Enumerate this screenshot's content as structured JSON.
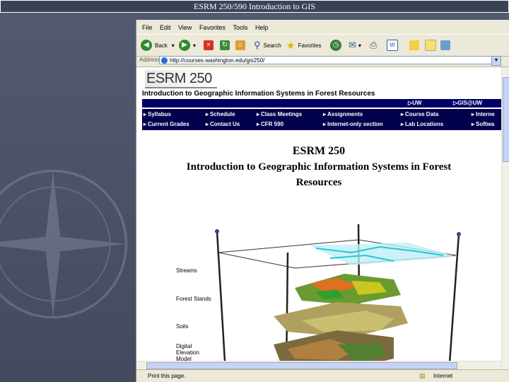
{
  "slide": {
    "title": "ESRM 250/590 Introduction to GIS"
  },
  "browser": {
    "menu": [
      "File",
      "Edit",
      "View",
      "Favorites",
      "Tools",
      "Help"
    ],
    "toolbar": {
      "back_label": "Back",
      "search_label": "Search",
      "favorites_label": "Favorites"
    },
    "address": {
      "label": "Address",
      "url": "http://courses.washington.edu/gis250/"
    },
    "status": {
      "text": "Print this page.",
      "zone": "Internet"
    }
  },
  "page": {
    "logo": "ESRM 250",
    "subtitle": "Introduction to Geographic Information Systems in Forest Resources",
    "top_links": [
      "UW Home",
      "GIS@UW"
    ],
    "nav_row1": [
      "Syllabus",
      "Schedule",
      "Class Meetings",
      "Assignments",
      "Course Data",
      "Interne"
    ],
    "nav_row2": [
      "Current Grades",
      "Contact Us",
      "CFR 590",
      "Internet-only section",
      "Lab Locations",
      "Softwa"
    ],
    "heading_line1": "ESRM 250",
    "heading_line2": "Introduction to Geographic Information Systems in Forest",
    "heading_line3": "Resources",
    "layers": [
      "Streams",
      "Forest Stands",
      "Soils",
      "Digital",
      "Elevation",
      "Model"
    ]
  },
  "colors": {
    "nav_bar": "#000066",
    "slide_bg": "#4a5064"
  }
}
